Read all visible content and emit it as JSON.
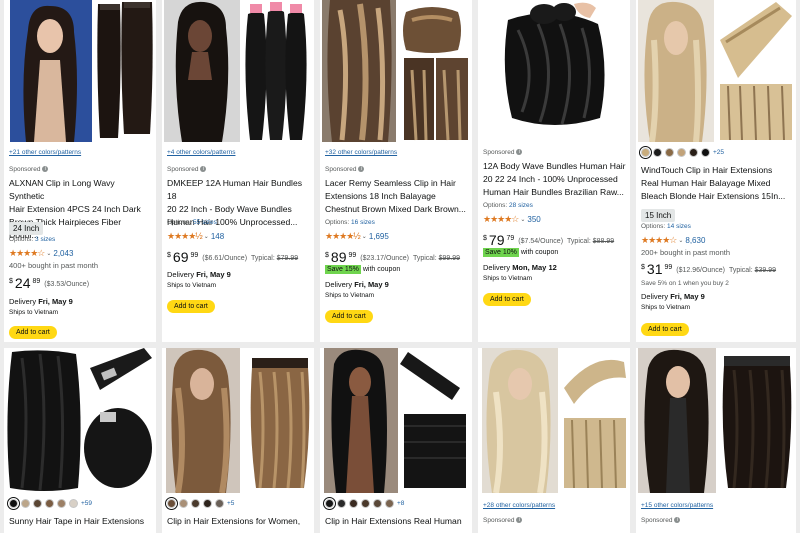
{
  "common": {
    "sponsored": "Sponsored",
    "add_to_cart": "Add to cart",
    "ships_to": "Ships to Vietnam",
    "delivery_prefix": "Delivery"
  },
  "products": [
    {
      "colors_link": "+21 other colors/patterns",
      "title_lines": [
        "ALXNAN Clip in Long Wavy Synthetic",
        "Hair Extension 4PCS 24 Inch Dark",
        "Brown Thick Hairpieces Fiber Doubl..."
      ],
      "option_btn": "24 Inch",
      "options_prefix": "Options:",
      "options_link": "3 sizes",
      "stars": "★★★★☆",
      "rating_count": "2,043",
      "bought": "400+ bought in past month",
      "price_sym": "$",
      "price_whole": "24",
      "price_frac": "89",
      "unit_price": "($3.53/Ounce)",
      "delivery_date": "Fri, May 9"
    },
    {
      "colors_link": "+4 other colors/patterns",
      "title_lines": [
        "DMKEEP 12A Human Hair Bundles 18",
        "20 22 Inch - Body Wave Bundles",
        "Human Hair 100% Unprocessed..."
      ],
      "options_prefix": "Options:",
      "options_link": "55 sizes",
      "stars": "★★★★½",
      "rating_count": "148",
      "price_sym": "$",
      "price_whole": "69",
      "price_frac": "99",
      "unit_price": "($6.61/Ounce)",
      "typical_label": "Typical:",
      "typical_price": "$79.99",
      "delivery_date": "Fri, May 9"
    },
    {
      "colors_link": "+32 other colors/patterns",
      "title_lines": [
        "Lacer Remy Seamless Clip in Hair",
        "Extensions 18 Inch Balayage",
        "Chestnut Brown Mixed Dark Brown..."
      ],
      "options_prefix": "Options:",
      "options_link": "16 sizes",
      "stars": "★★★★½",
      "rating_count": "1,695",
      "price_sym": "$",
      "price_whole": "89",
      "price_frac": "99",
      "unit_price": "($23.17/Ounce)",
      "typical_label": "Typical:",
      "typical_price": "$99.99",
      "save_badge": "Save 15%",
      "save_text": "with coupon",
      "delivery_date": "Fri, May 9"
    },
    {
      "title_lines": [
        "12A Body Wave Bundles Human Hair",
        "20 22 24 Inch - 100% Unprocessed",
        "Human Hair Bundles Brazilian Raw..."
      ],
      "options_prefix": "Options:",
      "options_link": "28 sizes",
      "stars": "★★★★☆",
      "rating_count": "350",
      "price_sym": "$",
      "price_whole": "79",
      "price_frac": "79",
      "unit_price": "($7.54/Ounce)",
      "typical_label": "Typical:",
      "typical_price": "$88.99",
      "save_badge": "Save 10%",
      "save_text": "with coupon",
      "delivery_date": "Mon, May 12"
    },
    {
      "swatch_colors": [
        "#c9ad7d",
        "#1c1c1c",
        "#8a6a46",
        "#c2a37a",
        "#2a2018",
        "#101010"
      ],
      "swatch_more": "+25",
      "title_lines": [
        "WindTouch Clip in Hair Extensions",
        "Real Human Hair Balayage Mixed",
        "Bleach Blonde Hair Extensions 15In..."
      ],
      "option_btn": "15 Inch",
      "options_prefix": "Options:",
      "options_link": "14 sizes",
      "stars": "★★★★☆",
      "rating_count": "8,630",
      "bought": "200+ bought in past month",
      "price_sym": "$",
      "price_whole": "31",
      "price_frac": "99",
      "unit_price": "($12.96/Ounce)",
      "typical_label": "Typical:",
      "typical_price": "$39.99",
      "save_text": "Save 5% on 1 when you buy 2",
      "delivery_date": "Fri, May 9"
    },
    {
      "swatch_colors": [
        "#101010",
        "#bca68a",
        "#5b4634",
        "#7a5c42",
        "#9c8066",
        "#d8d0c6"
      ],
      "swatch_more": "+59",
      "title_lines": [
        "Sunny Hair Tape in Hair Extensions"
      ]
    },
    {
      "swatch_colors": [
        "#6b4f38",
        "#a99077",
        "#4a3a2c",
        "#2e241c",
        "#6a6058"
      ],
      "swatch_more": "+5",
      "title_lines": [
        "Clip in Hair Extensions for Women,"
      ]
    },
    {
      "swatch_colors": [
        "#151515",
        "#2a2a2a",
        "#3a2a20",
        "#4a382a",
        "#5a4838",
        "#7a6450"
      ],
      "swatch_more": "+8",
      "title_lines": [
        "Clip in Hair Extensions Real Human"
      ]
    },
    {
      "colors_link": "+28 other colors/patterns"
    },
    {
      "colors_link": "+15 other colors/patterns"
    }
  ]
}
